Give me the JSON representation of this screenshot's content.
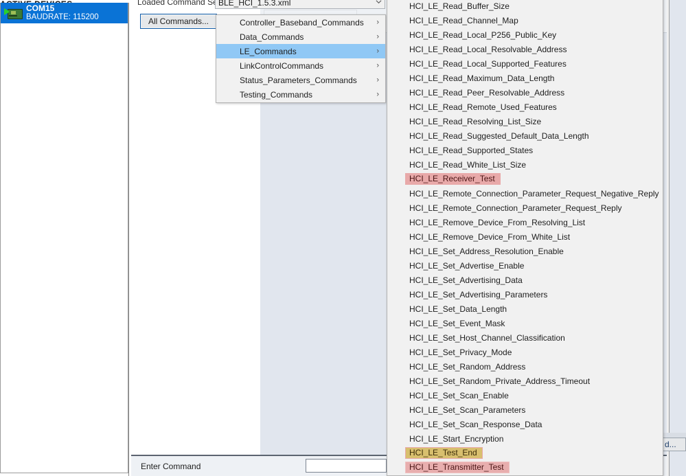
{
  "device_panel": {
    "header": "ACTIVE DEVICES",
    "devices": [
      {
        "name": "COM15",
        "baudrate": "BAUDRATE: 115200",
        "icon": "serial-device-icon"
      }
    ]
  },
  "toolbar": {
    "loaded_command_set_label": "Loaded Command Set",
    "command_set_value": "BLE_HCI_1.5.3.xml",
    "all_commands_button": "All Commands...",
    "chevron_icon": "chevron-down-icon"
  },
  "command_bar": {
    "enter_command_label": "Enter Command",
    "input_value": "",
    "input_placeholder": ""
  },
  "partial_button": {
    "label": "d..."
  },
  "category_menu": {
    "items": [
      {
        "label": "Controller_Baseband_Commands",
        "selected": false,
        "arrow": "chevron-right-icon"
      },
      {
        "label": "Data_Commands",
        "selected": false,
        "arrow": "chevron-right-icon"
      },
      {
        "label": "LE_Commands",
        "selected": true,
        "arrow": "chevron-right-icon"
      },
      {
        "label": "LinkControlCommands",
        "selected": false,
        "arrow": "chevron-right-icon"
      },
      {
        "label": "Status_Parameters_Commands",
        "selected": false,
        "arrow": "chevron-right-icon"
      },
      {
        "label": "Testing_Commands",
        "selected": false,
        "arrow": "chevron-right-icon"
      }
    ]
  },
  "commands_menu": {
    "items": [
      {
        "label": "HCI_LE_Read_Buffer_Size",
        "highlight": "none"
      },
      {
        "label": "HCI_LE_Read_Channel_Map",
        "highlight": "none"
      },
      {
        "label": "HCI_LE_Read_Local_P256_Public_Key",
        "highlight": "none"
      },
      {
        "label": "HCI_LE_Read_Local_Resolvable_Address",
        "highlight": "none"
      },
      {
        "label": "HCI_LE_Read_Local_Supported_Features",
        "highlight": "none"
      },
      {
        "label": "HCI_LE_Read_Maximum_Data_Length",
        "highlight": "none"
      },
      {
        "label": "HCI_LE_Read_Peer_Resolvable_Address",
        "highlight": "none"
      },
      {
        "label": "HCI_LE_Read_Remote_Used_Features",
        "highlight": "none"
      },
      {
        "label": "HCI_LE_Read_Resolving_List_Size",
        "highlight": "none"
      },
      {
        "label": "HCI_LE_Read_Suggested_Default_Data_Length",
        "highlight": "none"
      },
      {
        "label": "HCI_LE_Read_Supported_States",
        "highlight": "none"
      },
      {
        "label": "HCI_LE_Read_White_List_Size",
        "highlight": "none"
      },
      {
        "label": "HCI_LE_Receiver_Test",
        "highlight": "pink"
      },
      {
        "label": "HCI_LE_Remote_Connection_Parameter_Request_Negative_Reply",
        "highlight": "none"
      },
      {
        "label": "HCI_LE_Remote_Connection_Parameter_Request_Reply",
        "highlight": "none"
      },
      {
        "label": "HCI_LE_Remove_Device_From_Resolving_List",
        "highlight": "none"
      },
      {
        "label": "HCI_LE_Remove_Device_From_White_List",
        "highlight": "none"
      },
      {
        "label": "HCI_LE_Set_Address_Resolution_Enable",
        "highlight": "none"
      },
      {
        "label": "HCI_LE_Set_Advertise_Enable",
        "highlight": "none"
      },
      {
        "label": "HCI_LE_Set_Advertising_Data",
        "highlight": "none"
      },
      {
        "label": "HCI_LE_Set_Advertising_Parameters",
        "highlight": "none"
      },
      {
        "label": "HCI_LE_Set_Data_Length",
        "highlight": "none"
      },
      {
        "label": "HCI_LE_Set_Event_Mask",
        "highlight": "none"
      },
      {
        "label": "HCI_LE_Set_Host_Channel_Classification",
        "highlight": "none"
      },
      {
        "label": "HCI_LE_Set_Privacy_Mode",
        "highlight": "none"
      },
      {
        "label": "HCI_LE_Set_Random_Address",
        "highlight": "none"
      },
      {
        "label": "HCI_LE_Set_Random_Private_Address_Timeout",
        "highlight": "none"
      },
      {
        "label": "HCI_LE_Set_Scan_Enable",
        "highlight": "none"
      },
      {
        "label": "HCI_LE_Set_Scan_Parameters",
        "highlight": "none"
      },
      {
        "label": "HCI_LE_Set_Scan_Response_Data",
        "highlight": "none"
      },
      {
        "label": "HCI_LE_Start_Encryption",
        "highlight": "none"
      },
      {
        "label": "HCI_LE_Test_End",
        "highlight": "gold"
      },
      {
        "label": "HCI_LE_Transmitter_Test",
        "highlight": "pink2"
      }
    ]
  },
  "colors": {
    "selection_blue": "#0a73d6",
    "menu_selected_blue": "#90c8f5",
    "highlight_pink": "#e8a9a9",
    "highlight_gold": "#d8bf6e",
    "content_bg": "#e1e6ee",
    "menu_bg": "#f1f1f1"
  }
}
